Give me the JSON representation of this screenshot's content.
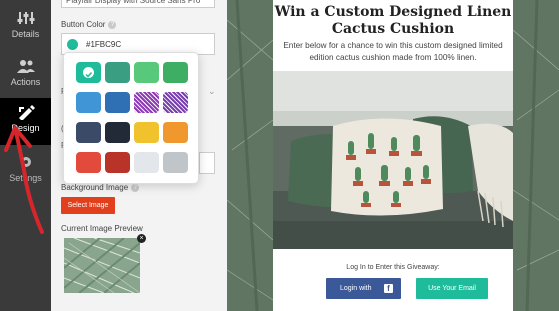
{
  "sidebar": {
    "items": [
      {
        "label": "Details",
        "icon": "sliders-icon"
      },
      {
        "label": "Actions",
        "icon": "people-icon"
      },
      {
        "label": "Design",
        "icon": "design-icon",
        "active": true
      },
      {
        "label": "Settings",
        "icon": "gear-icon"
      }
    ]
  },
  "panel": {
    "font_value": "Playfair Display with Source Sans Pro",
    "button_color_label": "Button Color",
    "button_color_hex": "#1FBC9C",
    "obscured_labels": [
      "P",
      "(",
      "P"
    ],
    "background_image_label": "Background Image",
    "select_image_label": "Select Image",
    "current_preview_label": "Current Image Preview",
    "close_glyph": "×"
  },
  "picker": {
    "selected": 0,
    "swatches": [
      {
        "color": "#1FBC9C",
        "style": "solid"
      },
      {
        "color": "#3a9e83",
        "style": "solid"
      },
      {
        "color": "#58c97a",
        "style": "solid"
      },
      {
        "color": "#3eae64",
        "style": "solid"
      },
      {
        "color": "#3f95d6",
        "style": "solid"
      },
      {
        "color": "#2f6fb3",
        "style": "solid"
      },
      {
        "color": "#8d3cb4",
        "style": "pattern"
      },
      {
        "color": "#7a3fae",
        "style": "pattern"
      },
      {
        "color": "#3b4a66",
        "style": "solid"
      },
      {
        "color": "#222a38",
        "style": "solid"
      },
      {
        "color": "#efc22e",
        "style": "solid"
      },
      {
        "color": "#f0972e",
        "style": "solid"
      },
      {
        "color": "#e24a3c",
        "style": "solid"
      },
      {
        "color": "#b83428",
        "style": "solid"
      },
      {
        "color": "#e3e6ea",
        "style": "solid"
      },
      {
        "color": "#c0c5c9",
        "style": "solid"
      }
    ]
  },
  "giveaway": {
    "title": "Win a Custom Designed Linen Cactus Cushion",
    "description": "Enter below for a chance to win this custom designed limited edition cactus cushion made from 100% linen.",
    "login_label": "Log In to Enter this Giveaway:",
    "facebook_button": "Login with",
    "facebook_glyph": "f",
    "email_button": "Use Your Email"
  },
  "colors": {
    "accent": "#1FBC9C",
    "facebook": "#3b5998",
    "select_button": "#e2401c",
    "sidebar": "#3a3a3a",
    "annotation_arrow": "#d6252b"
  }
}
